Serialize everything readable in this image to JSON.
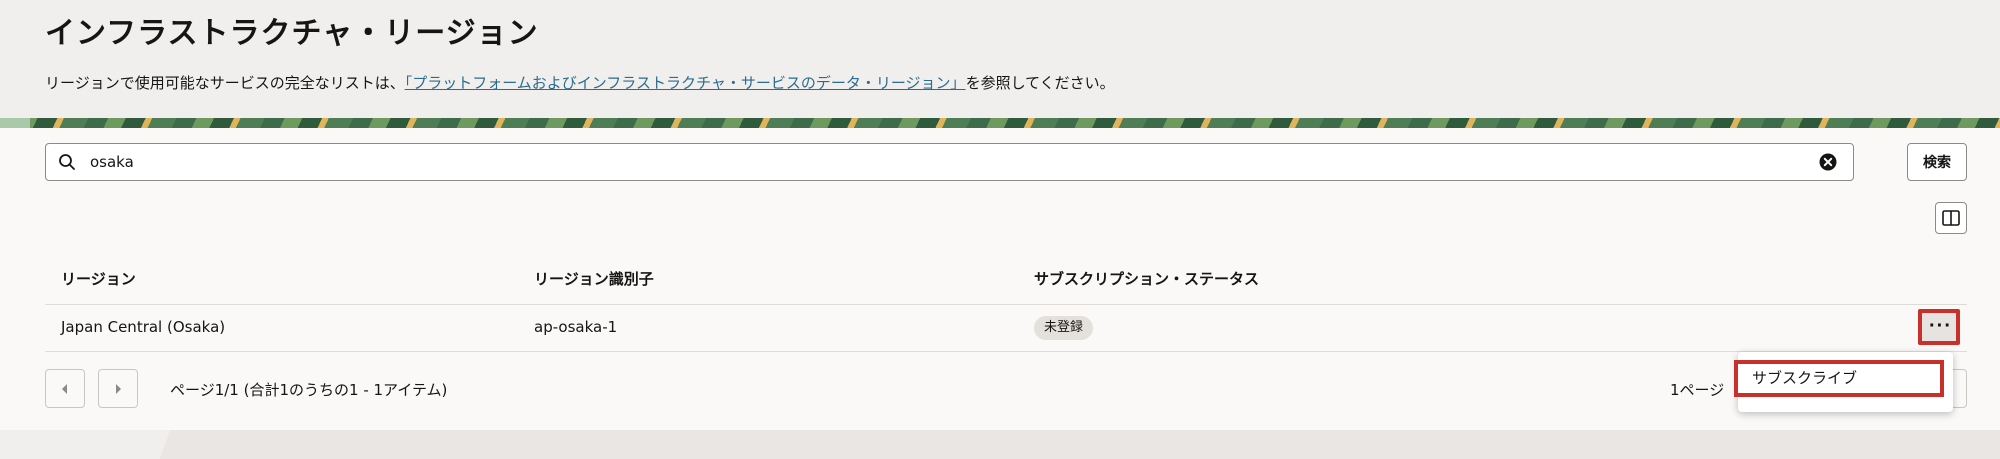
{
  "header": {
    "title": "インフラストラクチャ・リージョン",
    "desc_prefix": "リージョンで使用可能なサービスの完全なリストは、",
    "desc_link": "「プラットフォームおよびインフラストラクチャ・サービスのデータ・リージョン」",
    "desc_suffix": "を参照してください。"
  },
  "search": {
    "value": "osaka",
    "button_label": "検索",
    "icon": "search-icon",
    "clear_icon": "clear-icon"
  },
  "table": {
    "columns": [
      "リージョン",
      "リージョン識別子",
      "サブスクリプション・ステータス"
    ],
    "rows": [
      {
        "region": "Japan Central (Osaka)",
        "identifier": "ap-osaka-1",
        "status": "未登録",
        "actions_label": "···"
      }
    ]
  },
  "pagination": {
    "info": "ページ1/1 (合計1のうちの1 - 1アイテム)",
    "page_size_label": "1ページ"
  },
  "menu": {
    "items": [
      "サブスクライブ"
    ]
  },
  "colors": {
    "link": "#2a6c8f",
    "highlight": "#c7302b",
    "background": "#f1efed"
  }
}
